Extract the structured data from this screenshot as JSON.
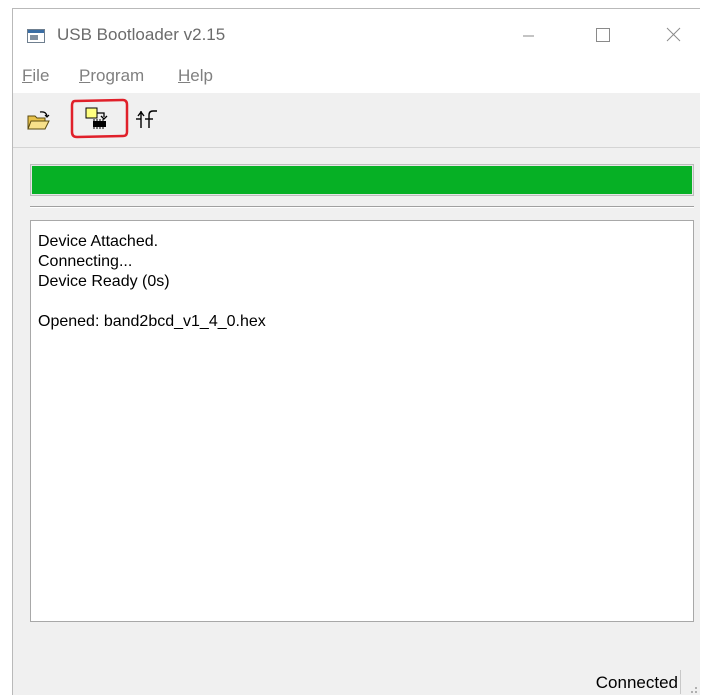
{
  "window": {
    "title": "USB Bootloader v2.15",
    "icon": "app-window-icon",
    "controls": [
      "minimize-icon",
      "maximize-icon",
      "close-icon"
    ]
  },
  "menu": {
    "items": [
      {
        "accel": "F",
        "rest": "ile"
      },
      {
        "accel": "P",
        "rest": "rogram"
      },
      {
        "accel": "H",
        "rest": "elp"
      }
    ]
  },
  "toolbar": {
    "buttons": [
      {
        "icon": "open-folder-icon"
      },
      {
        "icon": "program-chip-icon",
        "highlighted": true
      },
      {
        "icon": "reset-run-icon"
      }
    ],
    "highlight_color": "#e0202a"
  },
  "progress": {
    "value": 1.0,
    "color": "#06b025"
  },
  "log": {
    "lines": [
      "Device Attached.",
      "Connecting...",
      "Device Ready (0s)",
      "",
      "Opened: band2bcd_v1_4_0.hex"
    ]
  },
  "status": {
    "text": "Connected"
  }
}
